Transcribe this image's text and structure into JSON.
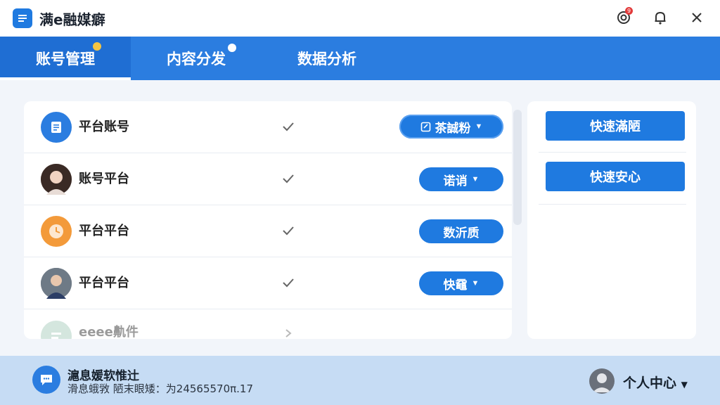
{
  "app": {
    "title": "满e融媒癖",
    "notify_badge": "9"
  },
  "tabs": [
    {
      "label": "账号管理",
      "active": true
    },
    {
      "label": "内容分发",
      "active": false
    },
    {
      "label": "数据分析",
      "active": false
    }
  ],
  "accounts": [
    {
      "name": "平台账号",
      "action_label": "茶誠粉",
      "action_icon": "edit-icon",
      "has_dropdown": true
    },
    {
      "name": "账号平台",
      "action_label": "诺诮",
      "has_dropdown": true
    },
    {
      "name": "平台平台",
      "action_label": "数沂质",
      "has_dropdown": false
    },
    {
      "name": "平台平台",
      "action_label": "快黿",
      "has_dropdown": true
    },
    {
      "name": "eeee鼽件",
      "action_label": "",
      "has_dropdown": false
    }
  ],
  "side": {
    "quick_button_1": "快速滿陋",
    "quick_button_2": "快速安心"
  },
  "footer": {
    "message_title": "滬息媛软惟辻",
    "message_sub": "滑息蛾敩   陋末眼矮：为24565570π.17",
    "user_label": "个人中心"
  },
  "colors": {
    "primary": "#2b7de0",
    "footer_bg": "#c6dcf4",
    "badge": "#e23b3b"
  }
}
